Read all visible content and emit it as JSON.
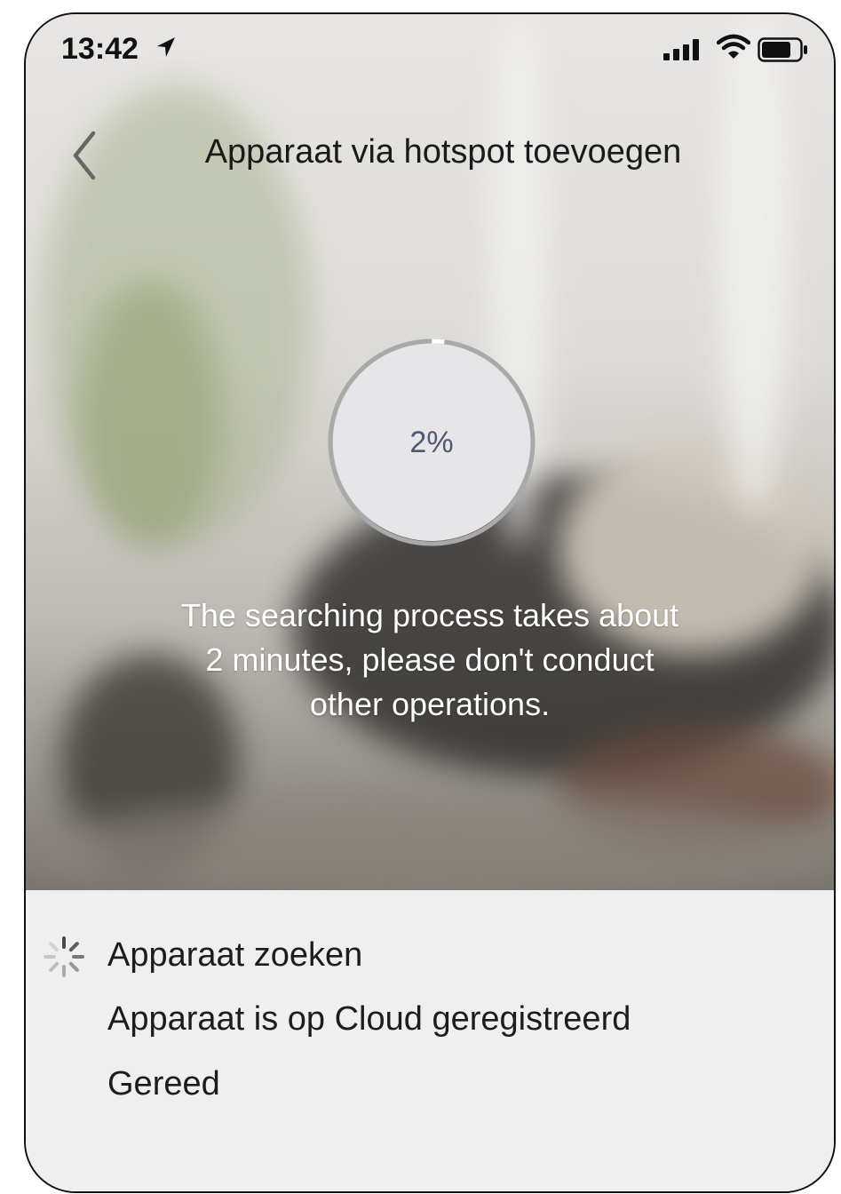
{
  "status_bar": {
    "time": "13:42",
    "icons": [
      "location-arrow-icon",
      "cellular-signal-icon",
      "wifi-icon",
      "battery-icon"
    ]
  },
  "nav": {
    "back_icon": "chevron-left-icon",
    "title": "Apparaat via hotspot toevoegen"
  },
  "progress": {
    "label": "2%",
    "value_percent": 2
  },
  "message": {
    "line1": "The searching process takes about",
    "line2": "2 minutes, please don't conduct",
    "line3": "other operations."
  },
  "steps": [
    {
      "label": "Apparaat zoeken",
      "state": "in-progress",
      "icon": "spinner-icon"
    },
    {
      "label": "Apparaat is op Cloud geregistreerd",
      "state": "pending"
    },
    {
      "label": "Gereed",
      "state": "pending"
    }
  ],
  "colors": {
    "progress_text": "#4e5872",
    "progress_ring": "#a9a9a9",
    "progress_arc": "#ffffff",
    "steps_background": "#efefef"
  }
}
